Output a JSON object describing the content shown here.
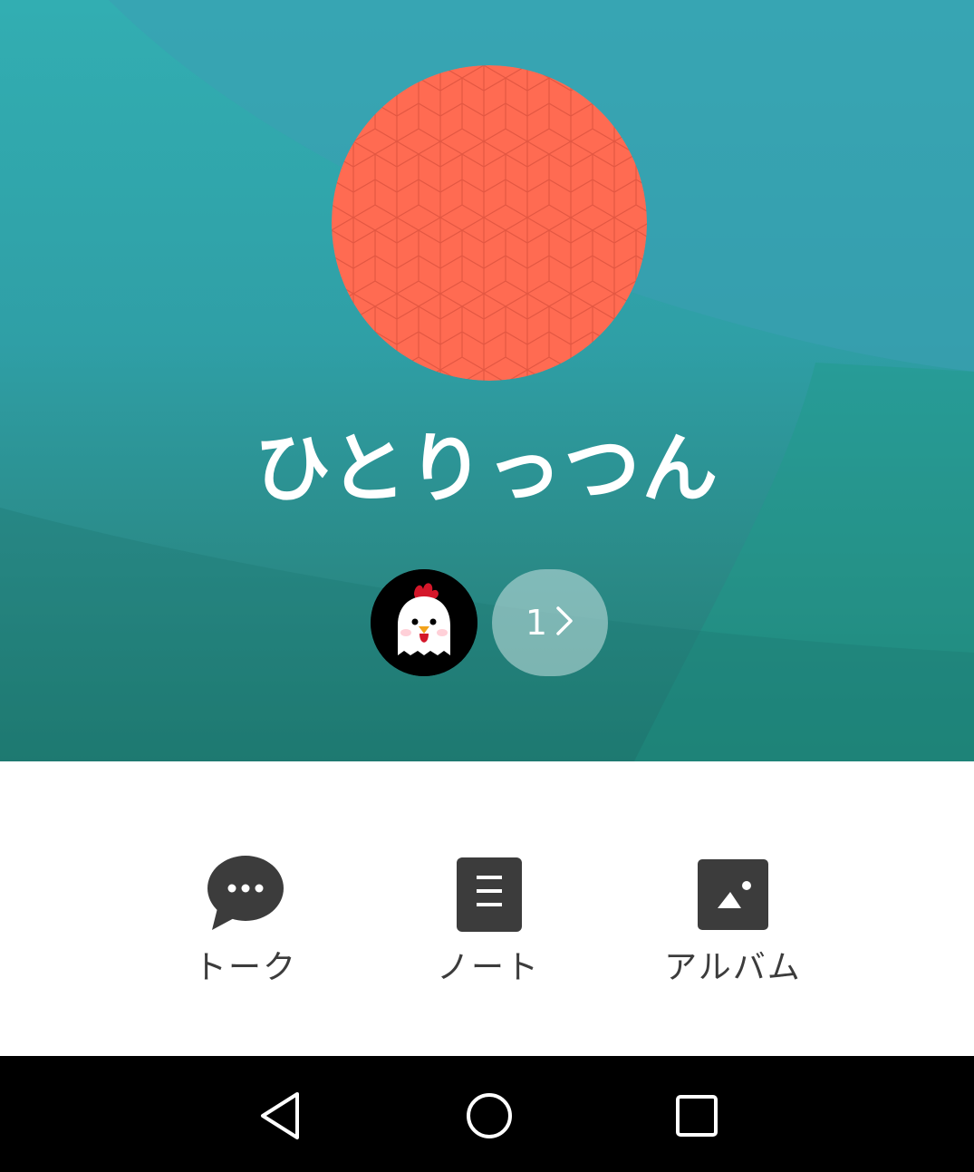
{
  "group": {
    "name": "ひとりっつん",
    "member_count": "1"
  },
  "actions": [
    {
      "label": "トーク",
      "icon": "chat-bubble-icon"
    },
    {
      "label": "ノート",
      "icon": "note-icon"
    },
    {
      "label": "アルバム",
      "icon": "album-icon"
    }
  ],
  "navbar": {
    "back_icon": "back-triangle-icon",
    "home_icon": "home-circle-icon",
    "recents_icon": "recents-square-icon"
  },
  "colors": {
    "cover_top": "#32aeb2",
    "cover_bottom": "#1f7a70",
    "group_avatar": "#ff6b52",
    "icon_gray": "#3c3c3c"
  }
}
